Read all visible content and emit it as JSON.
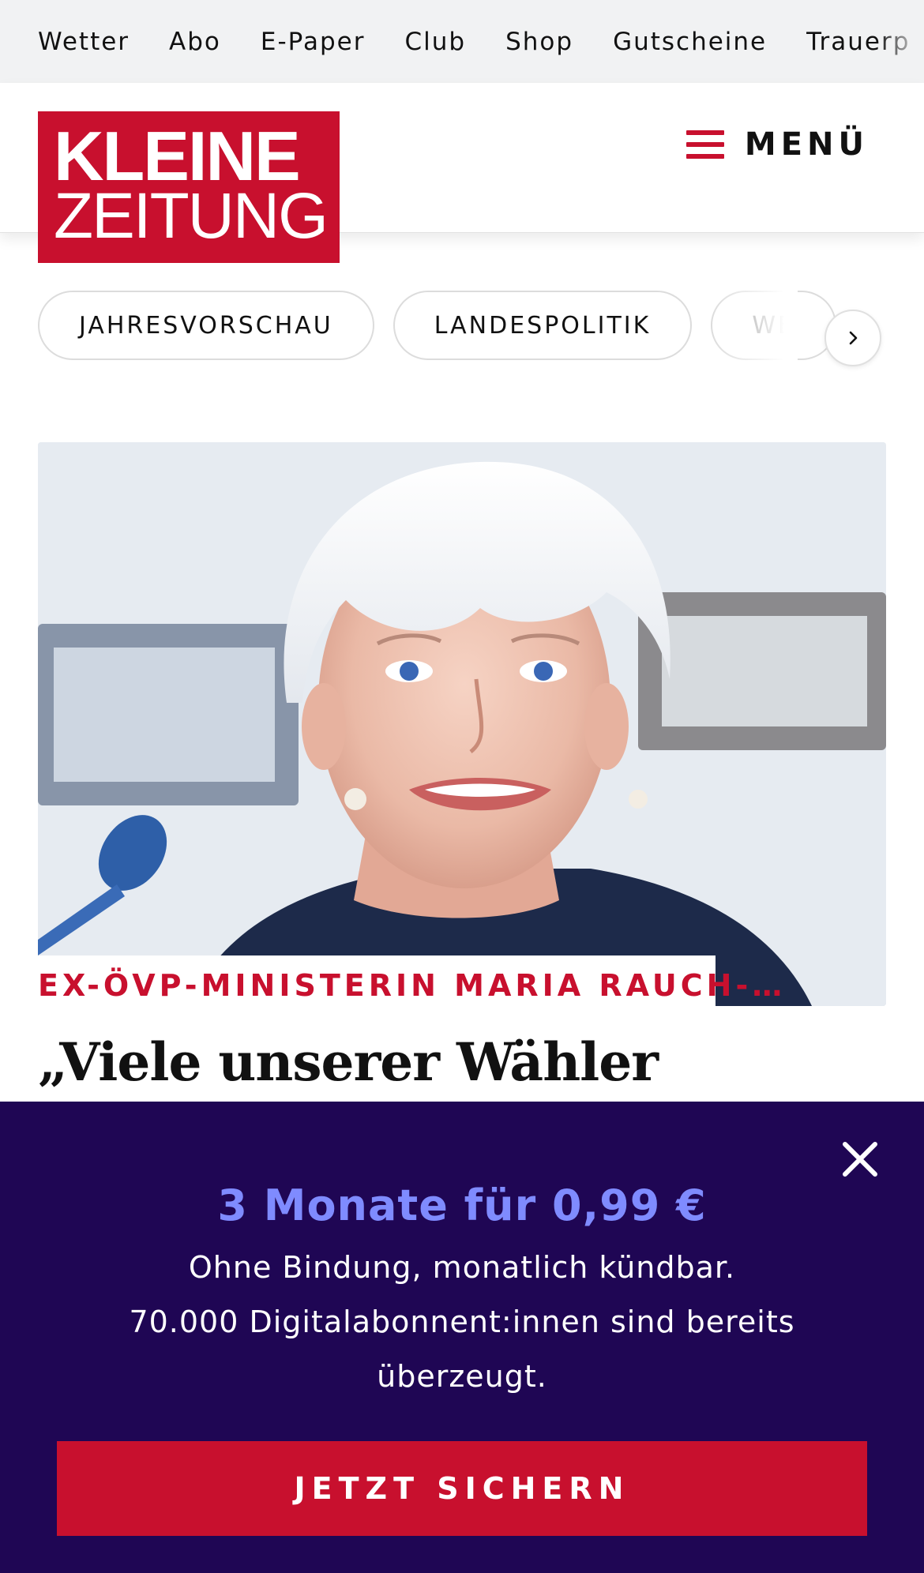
{
  "topnav": {
    "items": [
      "Wetter",
      "Abo",
      "E-Paper",
      "Club",
      "Shop",
      "Gutscheine",
      "Trauerp"
    ]
  },
  "header": {
    "logo": {
      "line1": "KLEINE",
      "line2": "ZEITUNG"
    },
    "menu_label": "MENÜ"
  },
  "tags": {
    "items": [
      "JAHRESVORSCHAU",
      "LANDESPOLITIK",
      "WE"
    ]
  },
  "article": {
    "kicker": "EX-ÖVP-MINISTERIN MARIA RAUCH-…",
    "headline": "„Viele unserer Wähler"
  },
  "paywall": {
    "title": "3 Monate für 0,99 €",
    "line1": "Ohne Bindung, monatlich kündbar.",
    "line2": "70.000 Digitalabonnent:innen sind bereits",
    "line3": "überzeugt.",
    "cta": "JETZT SICHERN"
  },
  "colors": {
    "brand_red": "#c8102e",
    "overlay_bg": "#1f0654",
    "offer_accent": "#7f8bff"
  },
  "icons": {
    "menu": "hamburger-icon",
    "next": "chevron-right-icon",
    "close": "close-icon"
  }
}
